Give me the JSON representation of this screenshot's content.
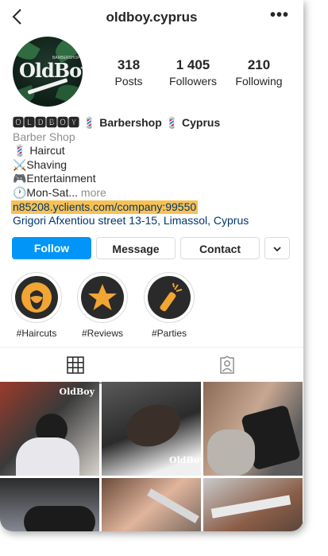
{
  "header": {
    "username": "oldboy.cyprus",
    "back_icon": "chevron-left-icon",
    "more_icon": "more-horizontal-icon",
    "more_label": "•••"
  },
  "avatar": {
    "logo_text": "OldBoy",
    "logo_sub": "BARBERSHOP"
  },
  "stats": [
    {
      "value": "318",
      "label": "Posts"
    },
    {
      "value": "1 405",
      "label": "Followers"
    },
    {
      "value": "210",
      "label": "Following"
    }
  ],
  "bio": {
    "name": "🅾🅻🅳🅱🅾🆈 💈 Barbershop 💈 Cyprus",
    "category": "Barber Shop",
    "lines": [
      "💈 Haircut",
      "⚔️Shaving",
      "🎮Entertainment",
      "🕐Mon-Sat... "
    ],
    "more_label": "more",
    "link": "n85208.yclients.com/company:99550",
    "address": "Grigori Afxentiou street  13-15, Limassol, Cyprus"
  },
  "buttons": {
    "follow": "Follow",
    "message": "Message",
    "contact": "Contact",
    "dropdown_icon": "chevron-down-icon"
  },
  "highlights": [
    {
      "label": "#Haircuts",
      "icon": "bearded-man-icon"
    },
    {
      "label": "#Reviews",
      "icon": "star-icon"
    },
    {
      "label": "#Parties",
      "icon": "firecracker-icon"
    }
  ],
  "tabs": [
    {
      "icon": "grid-icon",
      "active": true
    },
    {
      "icon": "tagged-person-icon",
      "active": false
    }
  ],
  "grid_watermark": "OldBoy",
  "colors": {
    "accent": "#0095f6",
    "link": "#00376b",
    "link_highlight": "#f8c154",
    "highlight_icon": "#f2a532"
  }
}
